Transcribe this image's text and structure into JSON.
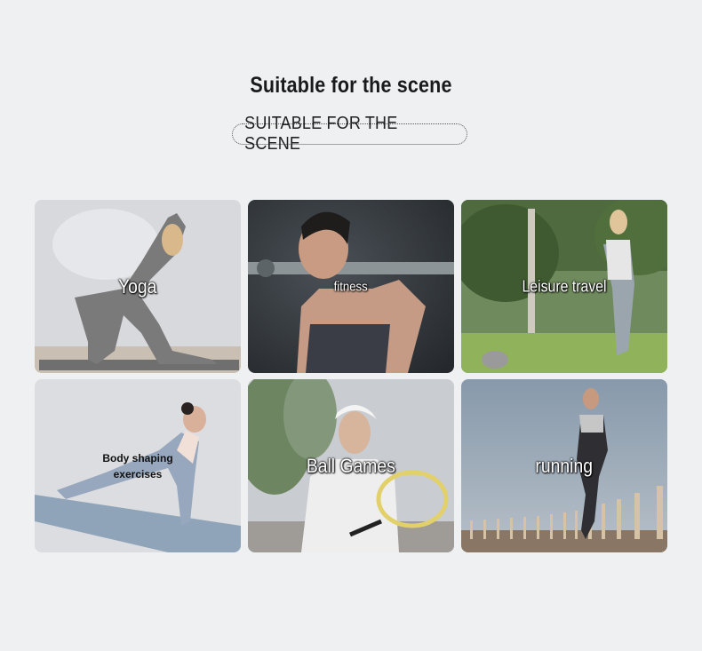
{
  "header": {
    "title": "Suitable for the scene",
    "subtitle": "SUITABLE FOR THE SCENE"
  },
  "scenes": [
    {
      "label": "Yoga"
    },
    {
      "label": "fitness"
    },
    {
      "label": "Leisure travel"
    },
    {
      "label": "Body shaping exercises"
    },
    {
      "label": "Ball Games"
    },
    {
      "label": "running"
    }
  ]
}
